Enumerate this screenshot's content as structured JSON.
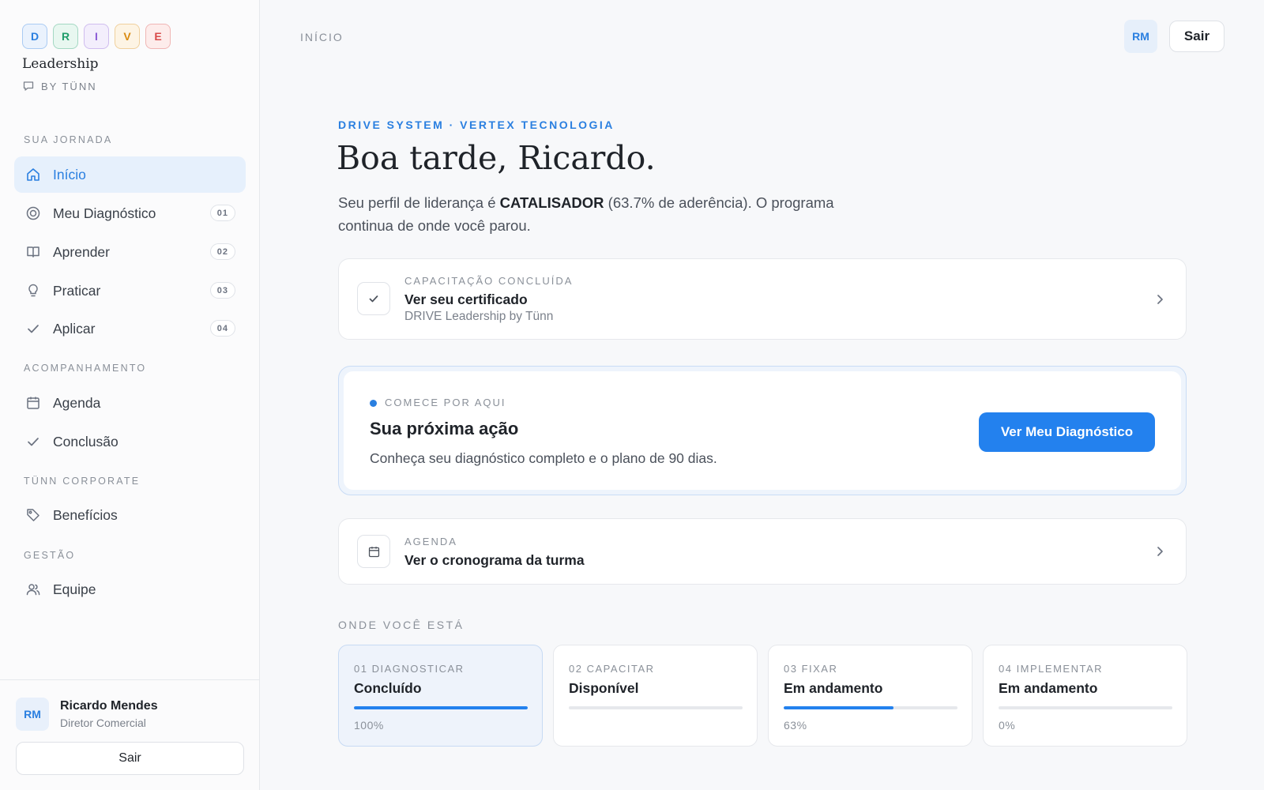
{
  "brand": {
    "letters": [
      {
        "char": "D",
        "color": "#2a7fe0",
        "bg": "#eaf2fd"
      },
      {
        "char": "R",
        "color": "#1f9d6a",
        "bg": "#e8f7f0"
      },
      {
        "char": "I",
        "color": "#8b5cd6",
        "bg": "#f3eefc"
      },
      {
        "char": "V",
        "color": "#d98a10",
        "bg": "#fdf4e4"
      },
      {
        "char": "E",
        "color": "#d94a4a",
        "bg": "#fdeceb"
      }
    ],
    "subtitle": "Leadership",
    "by": "BY TÜNN"
  },
  "sidebar": {
    "sections": [
      {
        "label": "SUA JORNADA"
      },
      {
        "label": "ACOMPANHAMENTO"
      },
      {
        "label": "TÜNN CORPORATE"
      },
      {
        "label": "GESTÃO"
      }
    ],
    "items": [
      {
        "label": "Início",
        "icon": "home-icon",
        "badge": ""
      },
      {
        "label": "Meu Diagnóstico",
        "icon": "target-icon",
        "badge": "01"
      },
      {
        "label": "Aprender",
        "icon": "book-icon",
        "badge": "02"
      },
      {
        "label": "Praticar",
        "icon": "lightbulb-icon",
        "badge": "03"
      },
      {
        "label": "Aplicar",
        "icon": "check-icon",
        "badge": "04"
      },
      {
        "label": "Agenda",
        "icon": "calendar-icon",
        "badge": ""
      },
      {
        "label": "Conclusão",
        "icon": "check-icon",
        "badge": ""
      },
      {
        "label": "Benefícios",
        "icon": "tag-icon",
        "badge": ""
      },
      {
        "label": "Equipe",
        "icon": "users-icon",
        "badge": ""
      }
    ]
  },
  "user": {
    "initials": "RM",
    "name": "Ricardo Mendes",
    "role": "Diretor Comercial",
    "logout_label": "Sair"
  },
  "topbar": {
    "breadcrumb": "INÍCIO",
    "avatar": "RM",
    "logout_label": "Sair"
  },
  "hero": {
    "eyebrow": "DRIVE SYSTEM · VERTEX TECNOLOGIA",
    "greeting": "Boa tarde, Ricardo.",
    "intro_before": "Seu perfil de liderança é ",
    "intro_profile": "CATALISADOR",
    "intro_after": " (63.7% de aderência). O programa continua de onde você parou."
  },
  "certificate_card": {
    "label": "CAPACITAÇÃO CONCLUÍDA",
    "title": "Ver seu certificado",
    "subtitle": "DRIVE Leadership by Tünn"
  },
  "next_action": {
    "label": "COMECE POR AQUI",
    "title": "Sua próxima ação",
    "description": "Conheça seu diagnóstico completo e o plano de 90 dias.",
    "button": "Ver Meu Diagnóstico"
  },
  "agenda_card": {
    "label": "AGENDA",
    "title": "Ver o cronograma da turma"
  },
  "progress": {
    "label": "ONDE VOCÊ ESTÁ",
    "stages": [
      {
        "label": "01 DIAGNOSTICAR",
        "status": "Concluído",
        "percent": 100,
        "percent_label": "100%"
      },
      {
        "label": "02 CAPACITAR",
        "status": "Disponível",
        "percent": 0,
        "percent_label": ""
      },
      {
        "label": "03 FIXAR",
        "status": "Em andamento",
        "percent": 63,
        "percent_label": "63%"
      },
      {
        "label": "04 IMPLEMENTAR",
        "status": "Em andamento",
        "percent": 0,
        "percent_label": "0%"
      }
    ]
  }
}
